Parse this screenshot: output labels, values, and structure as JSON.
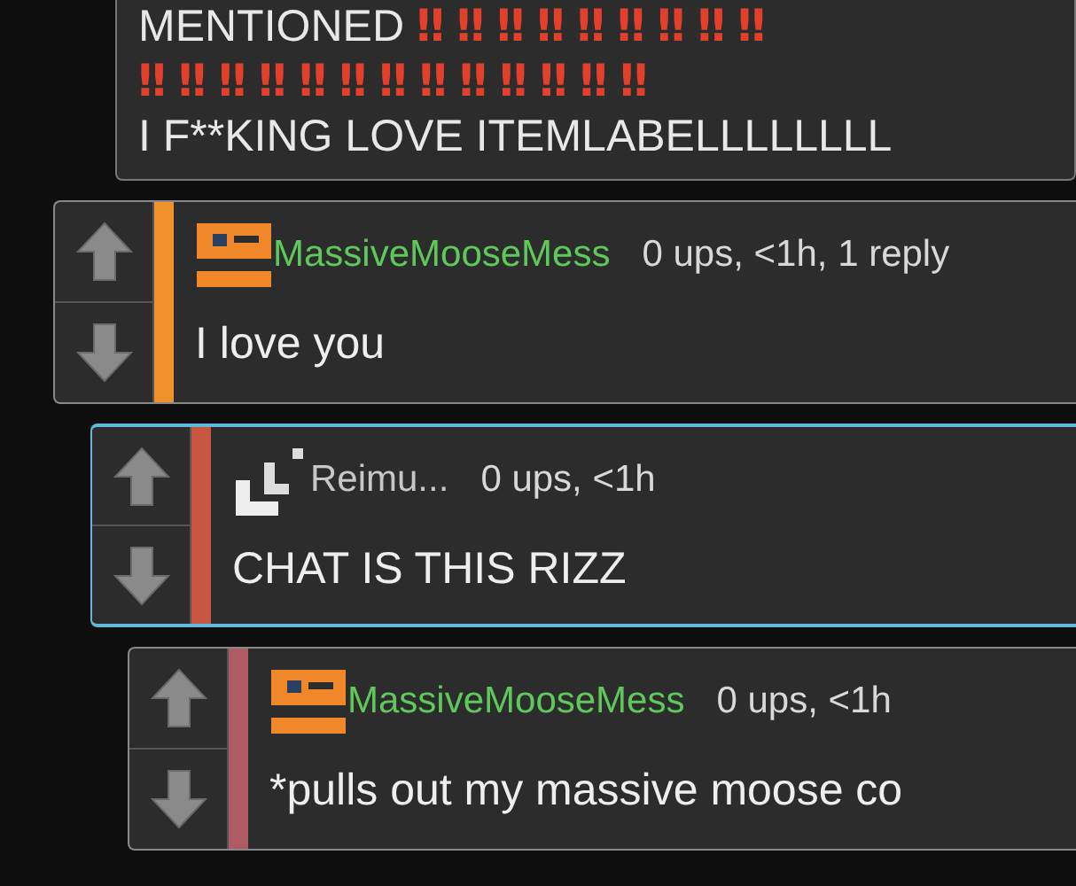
{
  "top_comment": {
    "lines": [
      "MENTIONED ‼ ‼ ‼ ‼ ‼ ‼ ‼ ‼ ‼",
      "‼ ‼ ‼ ‼ ‼ ‼ ‼ ‼ ‼ ‼ ‼ ‼ ‼",
      "I F**KING LOVE ITEMLABELLLLLLLL"
    ]
  },
  "comments": [
    {
      "author": "MassiveMooseMess",
      "author_highlighted": true,
      "avatar": {
        "kind": "block"
      },
      "meta": "0 ups, <1h, 1 reply",
      "body": "I love you",
      "color": "#f0922c",
      "selected": false,
      "children": [
        {
          "author": "Reimu...",
          "author_highlighted": false,
          "avatar": {
            "kind": "steps"
          },
          "meta": "0 ups, <1h",
          "body": "CHAT IS THIS RIZZ",
          "color": "#c8553f",
          "selected": true,
          "children": [
            {
              "author": "MassiveMooseMess",
              "author_highlighted": true,
              "avatar": {
                "kind": "block"
              },
              "meta": "0 ups, <1h",
              "body": "*pulls out my massive moose co",
              "color": "#b05a64",
              "selected": false
            }
          ]
        }
      ]
    }
  ]
}
